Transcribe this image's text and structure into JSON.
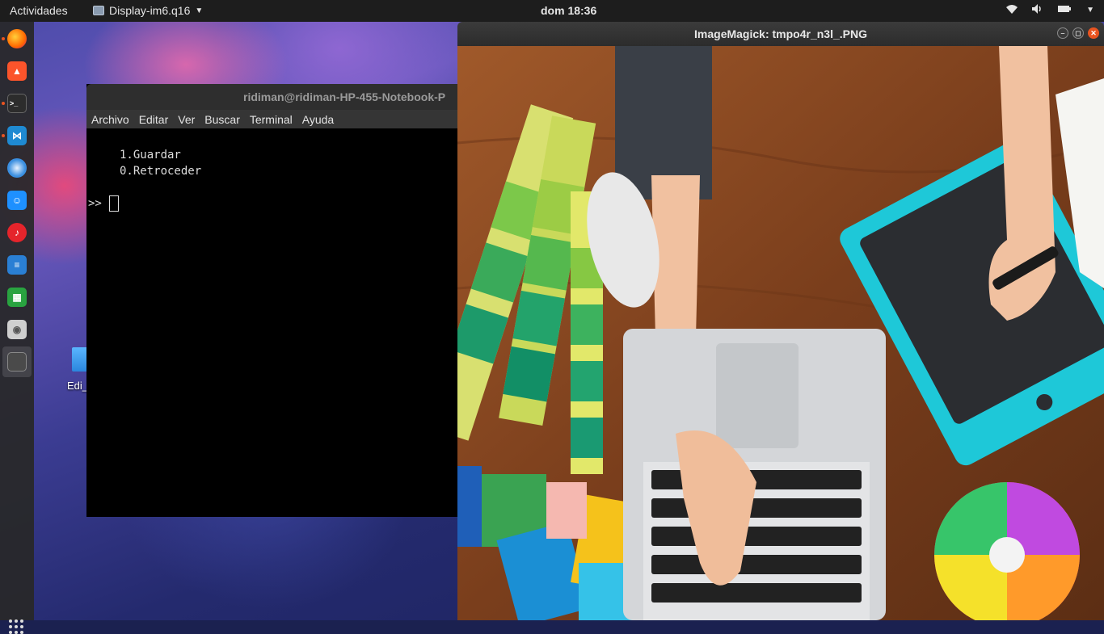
{
  "topbar": {
    "activities": "Actividades",
    "app_name": "Display-im6.q16",
    "clock": "dom 18:36"
  },
  "dock": {
    "items": [
      "firefox-icon",
      "brave-icon",
      "terminal-icon",
      "vscode-icon",
      "thunderbird-icon",
      "finder-icon",
      "music-icon",
      "writer-icon",
      "calc-icon",
      "disk-icon",
      "display-icon"
    ]
  },
  "desktop": {
    "icon_label": "Edi_"
  },
  "terminal": {
    "title": "ridiman@ridiman-HP-455-Notebook-P",
    "menu": [
      "Archivo",
      "Editar",
      "Ver",
      "Buscar",
      "Terminal",
      "Ayuda"
    ],
    "lines": [
      "1.Guardar",
      "0.Retroceder"
    ],
    "prompt": ">>"
  },
  "image_window": {
    "title": "ImageMagick: tmpo4r_n3l_.PNG"
  },
  "colors": {
    "accent": "#e95420",
    "tablet": "#1ec8d8",
    "desk": "#8a4a22"
  }
}
